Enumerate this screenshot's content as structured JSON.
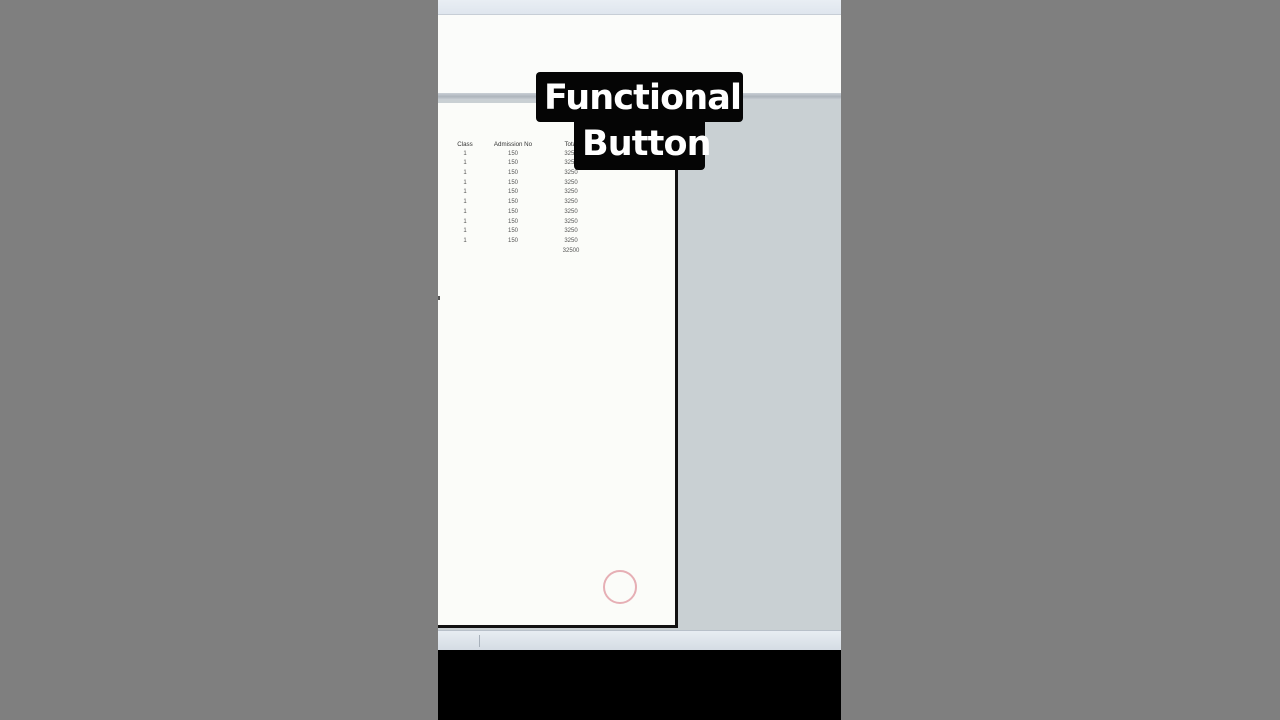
{
  "overlay": {
    "line1": "Functional",
    "line2": "Button"
  },
  "table": {
    "headers": [
      "Class",
      "Admission No",
      "Total"
    ],
    "rows": [
      [
        "1",
        "150",
        "3250"
      ],
      [
        "1",
        "150",
        "3250"
      ],
      [
        "1",
        "150",
        "3250"
      ],
      [
        "1",
        "150",
        "3250"
      ],
      [
        "1",
        "150",
        "3250"
      ],
      [
        "1",
        "150",
        "3250"
      ],
      [
        "1",
        "150",
        "3250"
      ],
      [
        "1",
        "150",
        "3250"
      ],
      [
        "1",
        "150",
        "3250"
      ],
      [
        "1",
        "150",
        "3250"
      ]
    ],
    "grand_total": "32500"
  },
  "icons": {
    "zoom": "magnifier-cursor-icon",
    "click": "click-indicator-icon"
  },
  "colors": {
    "background": "#7f7f7f",
    "document": "#fbfcf9",
    "caption": "#050505",
    "caption_text": "#ffffff",
    "workspace": "#c9d0d3"
  }
}
